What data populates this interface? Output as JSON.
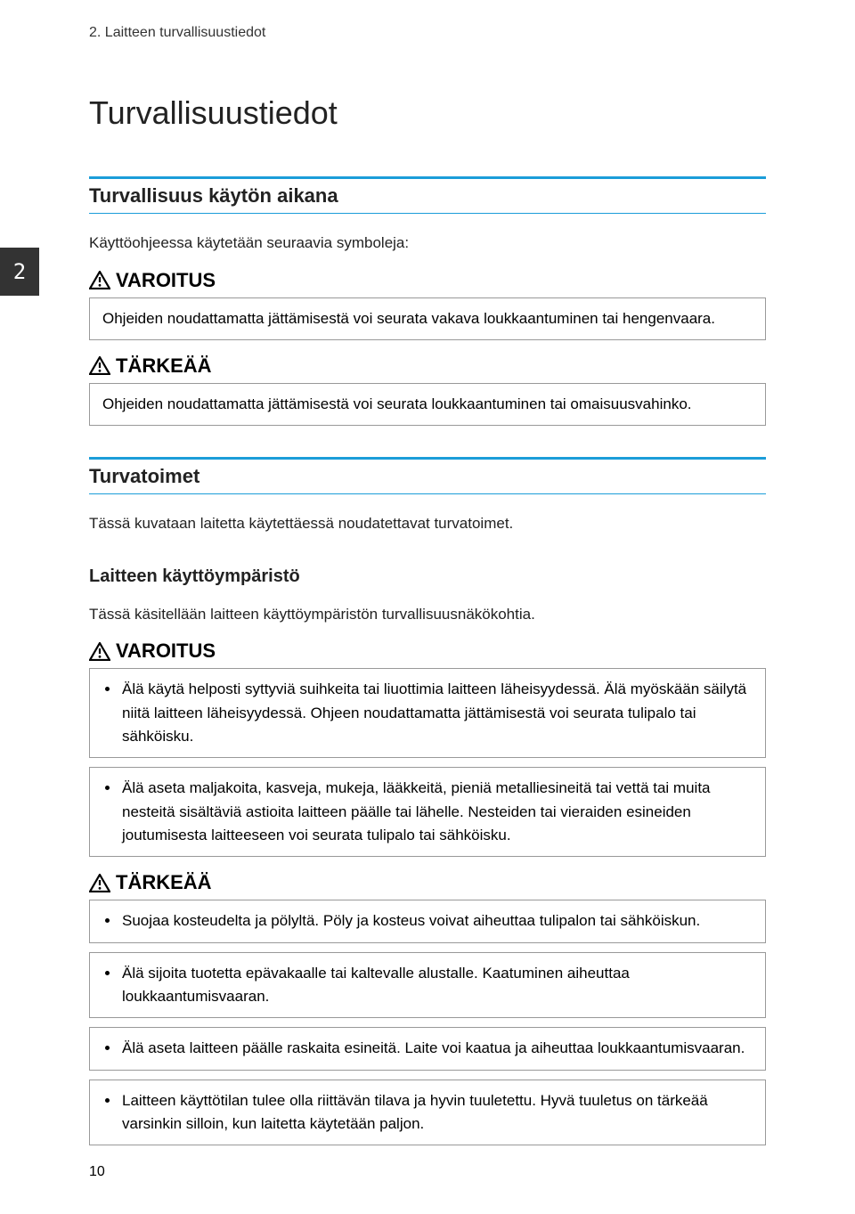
{
  "chapter_header": "2. Laitteen turvallisuustiedot",
  "page_title": "Turvallisuustiedot",
  "tab_number": "2",
  "section1": {
    "title": "Turvallisuus käytön aikana",
    "intro": "Käyttöohjeessa käytetään seuraavia symboleja:",
    "varoitus_label": "VAROITUS",
    "varoitus_text": "Ohjeiden noudattamatta jättämisestä voi seurata vakava loukkaantuminen tai hengenvaara.",
    "tarkeaa_label": "TÄRKEÄÄ",
    "tarkeaa_text": "Ohjeiden noudattamatta jättämisestä voi seurata loukkaantuminen tai omaisuusvahinko."
  },
  "section2": {
    "title": "Turvatoimet",
    "intro": "Tässä kuvataan laitetta käytettäessä noudatettavat turvatoimet."
  },
  "section3": {
    "title": "Laitteen käyttöympäristö",
    "intro": "Tässä käsitellään laitteen käyttöympäristön turvallisuusnäkökohtia.",
    "varoitus_label": "VAROITUS",
    "varoitus_items": [
      "Älä käytä helposti syttyviä suihkeita tai liuottimia laitteen läheisyydessä. Älä myöskään säilytä niitä laitteen läheisyydessä. Ohjeen noudattamatta jättämisestä voi seurata tulipalo tai sähköisku.",
      "Älä aseta maljakoita, kasveja, mukeja, lääkkeitä, pieniä metalliesineitä tai vettä tai muita nesteitä sisältäviä astioita laitteen päälle tai lähelle. Nesteiden tai vieraiden esineiden joutumisesta laitteeseen voi seurata tulipalo tai sähköisku."
    ],
    "tarkeaa_label": "TÄRKEÄÄ",
    "tarkeaa_items": [
      "Suojaa kosteudelta ja pölyltä. Pöly ja kosteus voivat aiheuttaa tulipalon tai sähköiskun.",
      "Älä sijoita tuotetta epävakaalle tai kaltevalle alustalle. Kaatuminen aiheuttaa loukkaantumisvaaran.",
      "Älä aseta laitteen päälle raskaita esineitä. Laite voi kaatua ja aiheuttaa loukkaantumisvaaran.",
      "Laitteen käyttötilan tulee olla riittävän tilava ja hyvin tuuletettu. Hyvä tuuletus on tärkeää varsinkin silloin, kun laitetta käytetään paljon."
    ]
  },
  "page_number": "10"
}
